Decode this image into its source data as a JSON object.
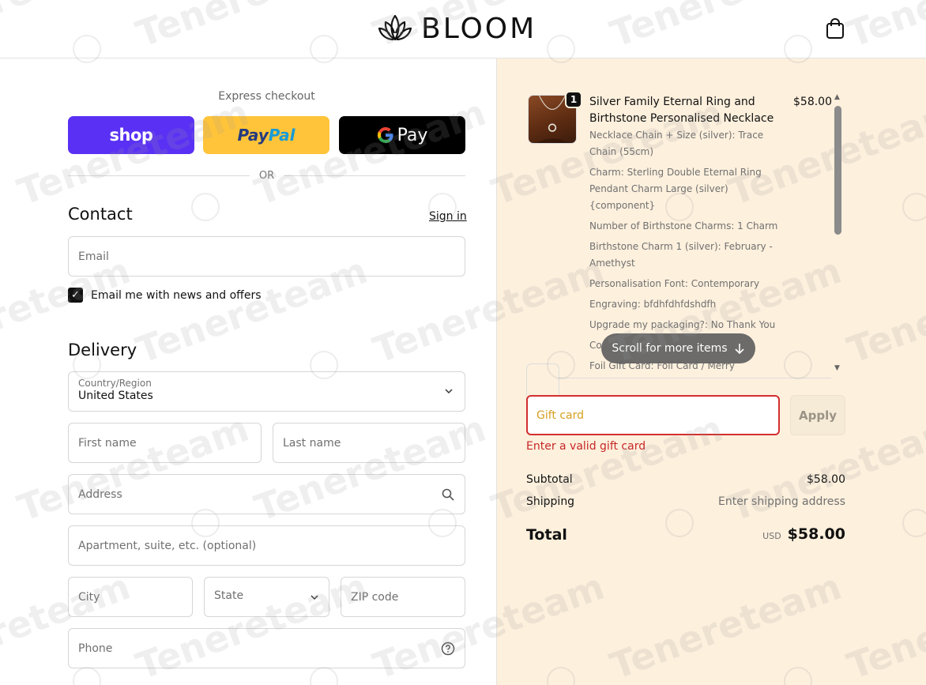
{
  "header": {
    "brand": "BLOOM",
    "icons": {
      "logo": "lotus-logo-icon",
      "cart": "shopping-bag-icon"
    }
  },
  "express": {
    "title": "Express checkout",
    "shop_label": "shop",
    "paypal_label_1": "Pay",
    "paypal_label_2": "Pal",
    "gpay_label": "Pay",
    "divider": "OR"
  },
  "contact": {
    "title": "Contact",
    "sign_in": "Sign in",
    "email_placeholder": "Email",
    "newsletter_label": "Email me with news and offers",
    "newsletter_checked": true
  },
  "delivery": {
    "title": "Delivery",
    "country_label": "Country/Region",
    "country_value": "United States",
    "first_name": "First name",
    "last_name": "Last name",
    "address": "Address",
    "apartment": "Apartment, suite, etc. (optional)",
    "city": "City",
    "state": "State",
    "zip": "ZIP code",
    "phone": "Phone"
  },
  "order": {
    "item": {
      "quantity": "1",
      "name": "Silver Family Eternal Ring and Birthstone Personalised Necklace",
      "price": "$58.00",
      "options": [
        "Necklace Chain + Size (silver): Trace Chain (55cm)",
        "Charm: Sterling Double Eternal Ring Pendant Charm Large (silver) {component}",
        "Number of Birthstone Charms: 1 Charm",
        "Birthstone Charm 1 (silver): February - Amethyst",
        "Personalisation Font: Contemporary",
        "Engraving: bfdhfdhfdshdfh",
        "Upgrade my packaging?: No Thank You",
        "Co",
        "Foil Gift Card: Foil Card / Merry"
      ]
    },
    "scroll_hint": "Scroll for more items",
    "gift_card_placeholder": "Gift card",
    "apply_label": "Apply",
    "gift_card_error": "Enter a valid gift card",
    "subtotal_label": "Subtotal",
    "subtotal_value": "$58.00",
    "shipping_label": "Shipping",
    "shipping_value": "Enter shipping address",
    "total_label": "Total",
    "total_currency": "USD",
    "total_value": "$58.00"
  },
  "watermark_text": "Tenereteam",
  "colors": {
    "shop_purple": "#5a31f4",
    "paypal_yellow": "#ffc439",
    "summary_bg": "#fdf0dd",
    "error_red": "#d32f2f"
  }
}
